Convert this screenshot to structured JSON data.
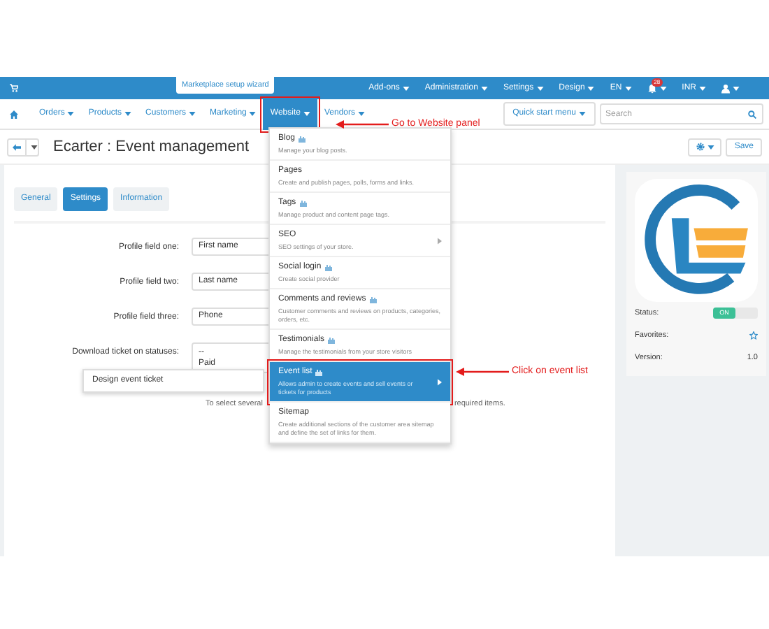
{
  "topbar": {
    "wizard": "Marketplace setup wizard",
    "items": [
      {
        "kind": "menu",
        "label": "Add-ons"
      },
      {
        "kind": "menu",
        "label": "Administration"
      },
      {
        "kind": "menu",
        "label": "Settings"
      },
      {
        "kind": "menu",
        "label": "Design"
      },
      {
        "kind": "menu",
        "label": "EN"
      },
      {
        "kind": "bell",
        "badge": "28"
      },
      {
        "kind": "menu",
        "label": "INR"
      },
      {
        "kind": "user"
      }
    ]
  },
  "nav": {
    "items": [
      {
        "label": "Orders",
        "selected": false,
        "outlined": false
      },
      {
        "label": "Products",
        "selected": false,
        "outlined": false
      },
      {
        "label": "Customers",
        "selected": false,
        "outlined": false
      },
      {
        "label": "Marketing",
        "selected": false,
        "outlined": false
      },
      {
        "label": "Website",
        "selected": true,
        "outlined": true
      },
      {
        "label": "Vendors",
        "selected": false,
        "outlined": false
      }
    ],
    "quick_start": "Quick start menu",
    "search": {
      "placeholder": "Search"
    }
  },
  "title": "Ecarter : Event management",
  "save": "Save",
  "tabs": [
    {
      "label": "General",
      "selected": false
    },
    {
      "label": "Settings",
      "selected": true
    },
    {
      "label": "Information",
      "selected": false
    }
  ],
  "fields": [
    {
      "kind": "input",
      "label": "Profile field one:",
      "value": "First name"
    },
    {
      "kind": "input",
      "label": "Profile field two:",
      "value": "Last name"
    },
    {
      "kind": "input",
      "label": "Profile field three:",
      "value": "Phone"
    },
    {
      "kind": "multiselect",
      "label": "Download ticket on statuses:",
      "options": [
        "--",
        "Paid"
      ]
    }
  ],
  "popup": "Design event ticket",
  "hint": {
    "start": "To select several",
    "end": "required items."
  },
  "menu": [
    {
      "title": "Blog",
      "description": "Manage your blog posts.",
      "addon": true,
      "submenu": false,
      "selected": false,
      "outlined": false
    },
    {
      "title": "Pages",
      "description": "Create and publish pages, polls, forms and links.",
      "addon": false,
      "submenu": false,
      "selected": false,
      "outlined": false
    },
    {
      "title": "Tags",
      "description": "Manage product and content page tags.",
      "addon": true,
      "submenu": false,
      "selected": false,
      "outlined": false
    },
    {
      "title": "SEO",
      "description": "SEO settings of your store.",
      "addon": false,
      "submenu": true,
      "selected": false,
      "outlined": false
    },
    {
      "title": "Social login",
      "description": "Create social provider",
      "addon": true,
      "submenu": false,
      "selected": false,
      "outlined": false
    },
    {
      "title": "Comments and reviews",
      "description": "Customer comments and reviews on products, categories, orders, etc.",
      "addon": true,
      "submenu": false,
      "selected": false,
      "outlined": false
    },
    {
      "title": "Testimonials",
      "description": "Manage the testimonials from your store visitors",
      "addon": true,
      "submenu": false,
      "selected": false,
      "outlined": false
    },
    {
      "title": "Event list",
      "description": "Allows admin to create events and sell events or tickets for products",
      "addon": true,
      "submenu": true,
      "selected": true,
      "outlined": true
    },
    {
      "title": "Sitemap",
      "description": "Create additional sections of the customer area sitemap and define the set of links for them.",
      "addon": false,
      "submenu": false,
      "selected": false,
      "outlined": false
    }
  ],
  "addon_panel": {
    "status_label": "Status:",
    "status": {
      "label": "ON",
      "on": true
    },
    "favorites_label": "Favorites:",
    "version_label": "Version:",
    "version": "1.0"
  },
  "annotations": [
    {
      "text": "Go to Website panel"
    },
    {
      "text": "Click on event list"
    }
  ]
}
